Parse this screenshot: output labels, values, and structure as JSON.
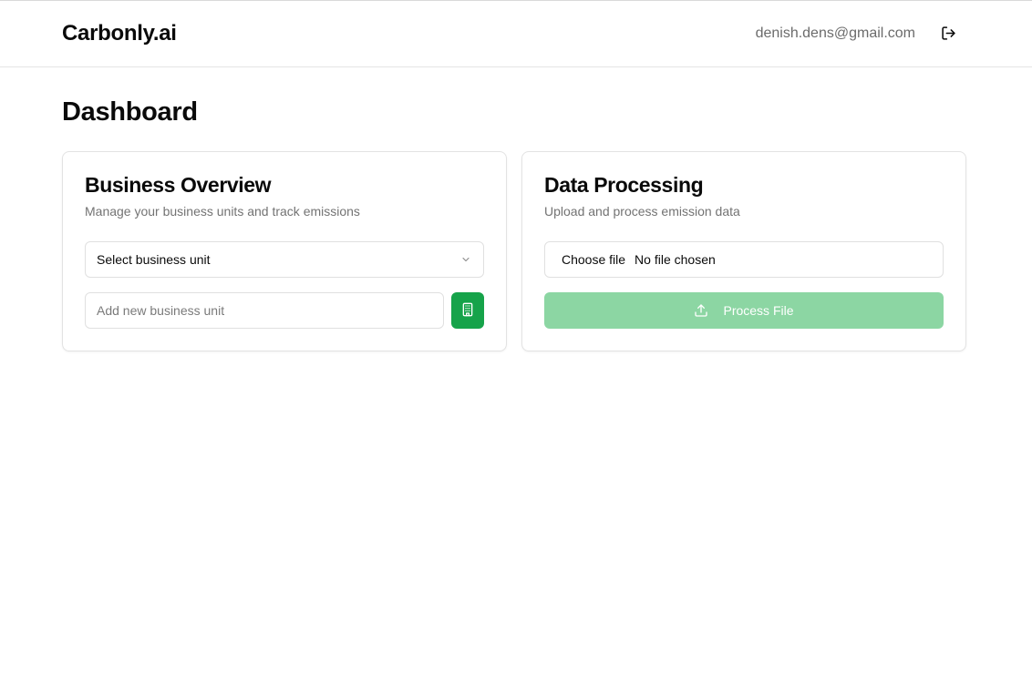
{
  "header": {
    "brand": "Carbonly.ai",
    "user_email": "denish.dens@gmail.com",
    "logout_icon": "logout-icon"
  },
  "page": {
    "title": "Dashboard"
  },
  "business_overview": {
    "title": "Business Overview",
    "subtitle": "Manage your business units and track emissions",
    "select_value": "Select business unit",
    "new_unit_placeholder": "Add new business unit",
    "add_button_icon": "building-icon",
    "accent_color": "#16a34a"
  },
  "data_processing": {
    "title": "Data Processing",
    "subtitle": "Upload and process emission data",
    "choose_file_label": "Choose file",
    "file_status": "No file chosen",
    "process_button_label": "Process File",
    "process_button_icon": "upload-icon",
    "process_button_color": "#8cd6a3"
  }
}
